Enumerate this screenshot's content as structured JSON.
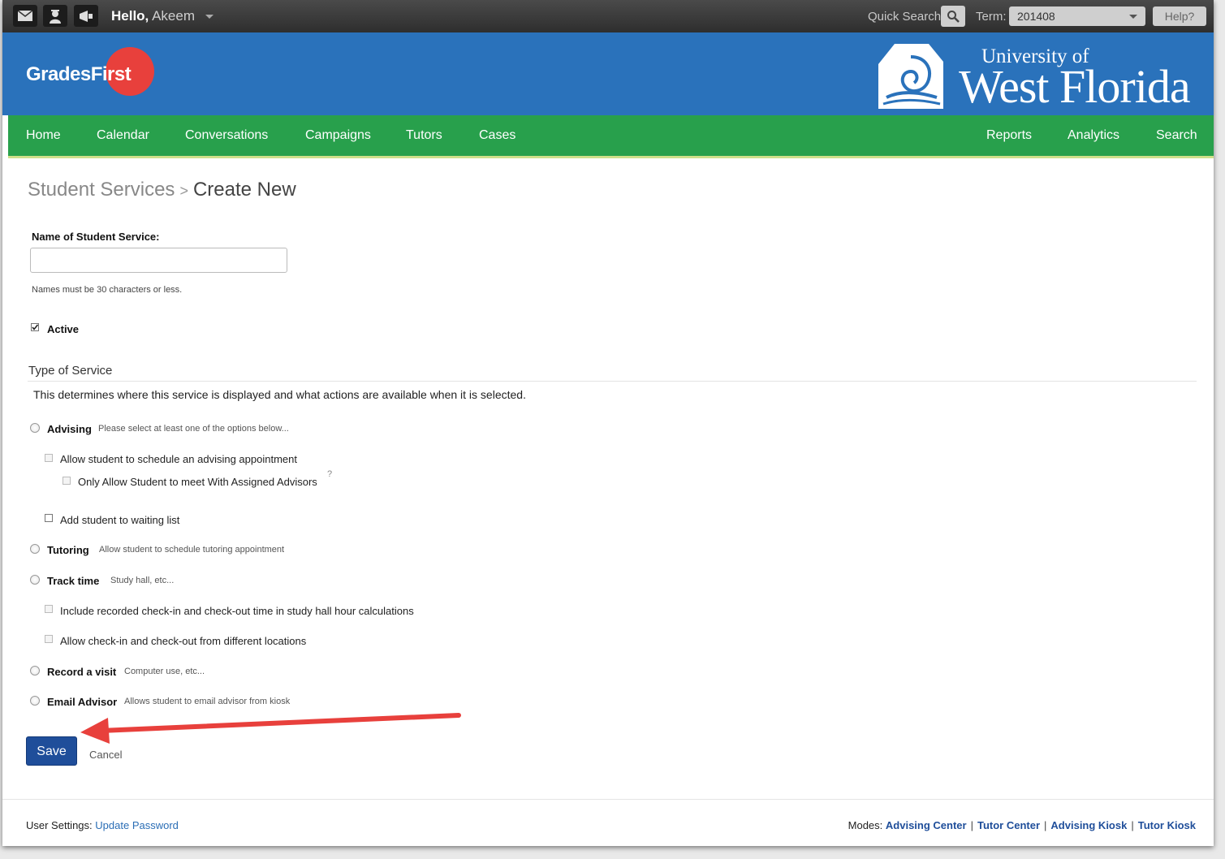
{
  "topbar": {
    "greeting": "Hello,",
    "user_name": "Akeem",
    "quick_search_label": "Quick Search:",
    "term_label": "Term:",
    "term_value": "201408",
    "help_label": "Help?"
  },
  "brand": {
    "logo_text": "GradesFirst",
    "university_line1": "University of",
    "university_line2": "West Florida"
  },
  "nav": {
    "left": [
      "Home",
      "Calendar",
      "Conversations",
      "Campaigns",
      "Tutors",
      "Cases"
    ],
    "right": [
      "Reports",
      "Analytics",
      "Search"
    ]
  },
  "breadcrumb": {
    "parent": "Student Services",
    "separator": ">",
    "current": "Create New"
  },
  "form": {
    "name_label": "Name of Student Service:",
    "name_value": "",
    "name_hint": "Names must be 30 characters or less.",
    "active_label": "Active",
    "active_checked": true,
    "type_title": "Type of Service",
    "type_desc": "This determines where this service is displayed and what actions are available when it is selected.",
    "advising": {
      "label": "Advising",
      "sub": "Please select at least one of the options below...",
      "opt_schedule": "Allow student to schedule an advising appointment",
      "opt_assigned": "Only Allow Student to meet With Assigned Advisors",
      "opt_assigned_help": "?",
      "opt_waiting": "Add student to waiting list"
    },
    "tutoring": {
      "label": "Tutoring",
      "sub": "Allow student to schedule tutoring appointment"
    },
    "track_time": {
      "label": "Track time",
      "sub": "Study hall, etc...",
      "opt_include": "Include recorded check-in and check-out time in study hall hour calculations",
      "opt_locations": "Allow check-in and check-out from different locations"
    },
    "record_visit": {
      "label": "Record a visit",
      "sub": "Computer use, etc..."
    },
    "email_advisor": {
      "label": "Email Advisor",
      "sub": "Allows student to email advisor from kiosk"
    },
    "save_label": "Save",
    "cancel_label": "Cancel"
  },
  "footer": {
    "user_settings_label": "User Settings:",
    "update_password": "Update Password",
    "modes_label": "Modes:",
    "modes": [
      "Advising Center",
      "Tutor Center",
      "Advising Kiosk",
      "Tutor Kiosk"
    ]
  },
  "colors": {
    "brand_blue": "#2a72bb",
    "nav_green": "#28a04c",
    "save_blue": "#1f4e9a",
    "arrow_red": "#e8403c"
  }
}
